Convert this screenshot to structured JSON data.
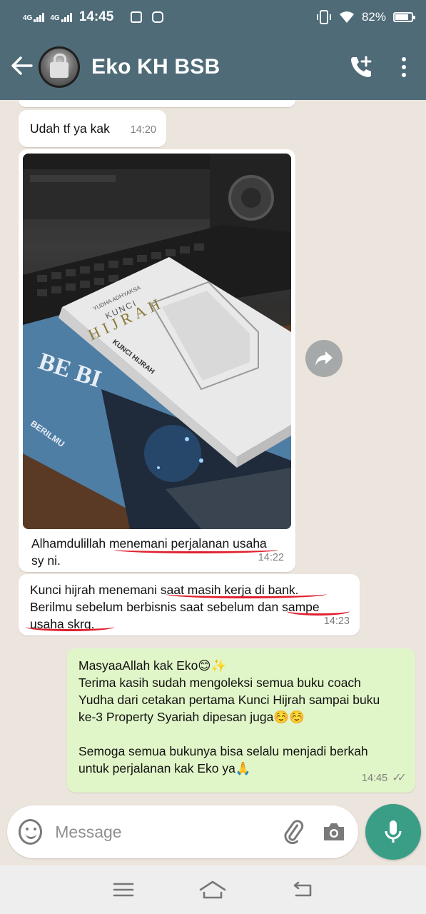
{
  "status_bar": {
    "network_1": "4G",
    "network_2": "4G",
    "time": "14:45",
    "battery": "82%",
    "battery_level": 0.82,
    "icons": [
      "signal-icon",
      "signal-icon",
      "mail-icon",
      "instagram-icon",
      "vibrate-icon",
      "wifi-icon",
      "battery-icon"
    ]
  },
  "header": {
    "title": "Eko KH BSB",
    "icons": [
      "back-arrow-icon",
      "add-call-icon",
      "more-vert-icon"
    ]
  },
  "messages": [
    {
      "id": "m1",
      "direction": "incoming",
      "text": "Udah tf ya kak",
      "time": "14:20"
    },
    {
      "id": "m2",
      "direction": "incoming",
      "type": "image",
      "image_text": {
        "author": "YUDHA ADHYAKSA",
        "title_small": "KUNCI",
        "title_big": "HIJRAH",
        "spine": "KUNCI HIJRAH",
        "book2_title": "BE BI",
        "book2_spine": "BERILMU"
      },
      "caption": "Alhamdulillah menemani perjalanan usaha sy ni.",
      "time": "14:22"
    },
    {
      "id": "m3",
      "direction": "incoming",
      "line1": "Kunci hijrah menemani saat masih kerja di bank.",
      "line2": "Berilmu sebelum berbisnis saat sebelum dan sampe",
      "line3": "usaha skrg.",
      "time": "14:23"
    },
    {
      "id": "m4",
      "direction": "outgoing",
      "line1": "MasyaaAllah kak Eko😊✨",
      "line2": "Terima kasih sudah mengoleksi semua buku coach",
      "line3": "Yudha dari cetakan pertama Kunci Hijrah sampai buku",
      "line4": "ke-3 Property Syariah dipesan juga☺️☺️",
      "line5": "Semoga semua bukunya bisa selalu menjadi berkah",
      "line6": "untuk perjalanan kak Eko ya🙏",
      "time": "14:45",
      "status": "read"
    }
  ],
  "input": {
    "placeholder": "Message",
    "value": "",
    "icons": [
      "emoji-icon",
      "attach-icon",
      "camera-icon",
      "mic-icon"
    ]
  },
  "nav": {
    "icons": [
      "menu-icon",
      "home-icon",
      "back-icon"
    ]
  },
  "colors": {
    "header": "#4f6b78",
    "chat_bg": "#ece5dd",
    "outgoing_bubble": "#e1f6c8",
    "incoming_bubble": "#ffffff",
    "accent": "#3a9e86",
    "annotation": "#e0202e"
  }
}
